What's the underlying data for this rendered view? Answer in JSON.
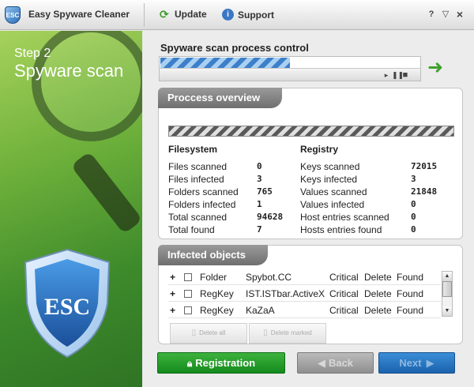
{
  "titlebar": {
    "app_title": "Easy Spyware Cleaner",
    "logo_text": "ESC",
    "update_label": "Update",
    "support_label": "Support",
    "help_label": "?",
    "minimize_label": "▽",
    "close_label": "×"
  },
  "sidebar": {
    "step_label": "Step 2",
    "step_title": "Spyware scan",
    "shield_text": "ESC"
  },
  "scan": {
    "title": "Spyware scan process control",
    "progress": 0.5
  },
  "overview": {
    "title": "Proccess overview",
    "filesystem_heading": "Filesystem",
    "registry_heading": "Registry",
    "filesystem": [
      {
        "label": "Files scanned",
        "value": "0"
      },
      {
        "label": "Files infected",
        "value": "3"
      },
      {
        "label": "Folders scanned",
        "value": "765"
      },
      {
        "label": "Folders infected",
        "value": "1"
      },
      {
        "label": "Total scanned",
        "value": "94628"
      },
      {
        "label": "Total found",
        "value": "7"
      }
    ],
    "registry": [
      {
        "label": "Keys scanned",
        "value": "72015"
      },
      {
        "label": "Keys infected",
        "value": "3"
      },
      {
        "label": "Values scanned",
        "value": "21848"
      },
      {
        "label": "Values infected",
        "value": "0"
      },
      {
        "label": "Host entries scanned",
        "value": "0"
      },
      {
        "label": "Hosts entries found",
        "value": "0"
      }
    ]
  },
  "infected": {
    "title": "Infected objects",
    "rows": [
      {
        "type": "Folder",
        "name": "Spybot.CC",
        "level": "Critical",
        "action": "Delete",
        "status": "Found"
      },
      {
        "type": "RegKey",
        "name": "IST.ISTbar.ActiveX",
        "level": "Critical",
        "action": "Delete",
        "status": "Found"
      },
      {
        "type": "RegKey",
        "name": "KaZaA",
        "level": "Critical",
        "action": "Delete",
        "status": "Found"
      }
    ],
    "delete_all_label": "Delete all",
    "delete_marked_label": "Delete marked"
  },
  "buttons": {
    "registration": "Registration",
    "back": "Back",
    "next": "Next"
  },
  "colors": {
    "sidebar_green": "#6fb13b",
    "registration_green": "#1f9a26",
    "next_blue": "#2a78c4",
    "progress_blue": "#3d7fc9"
  }
}
